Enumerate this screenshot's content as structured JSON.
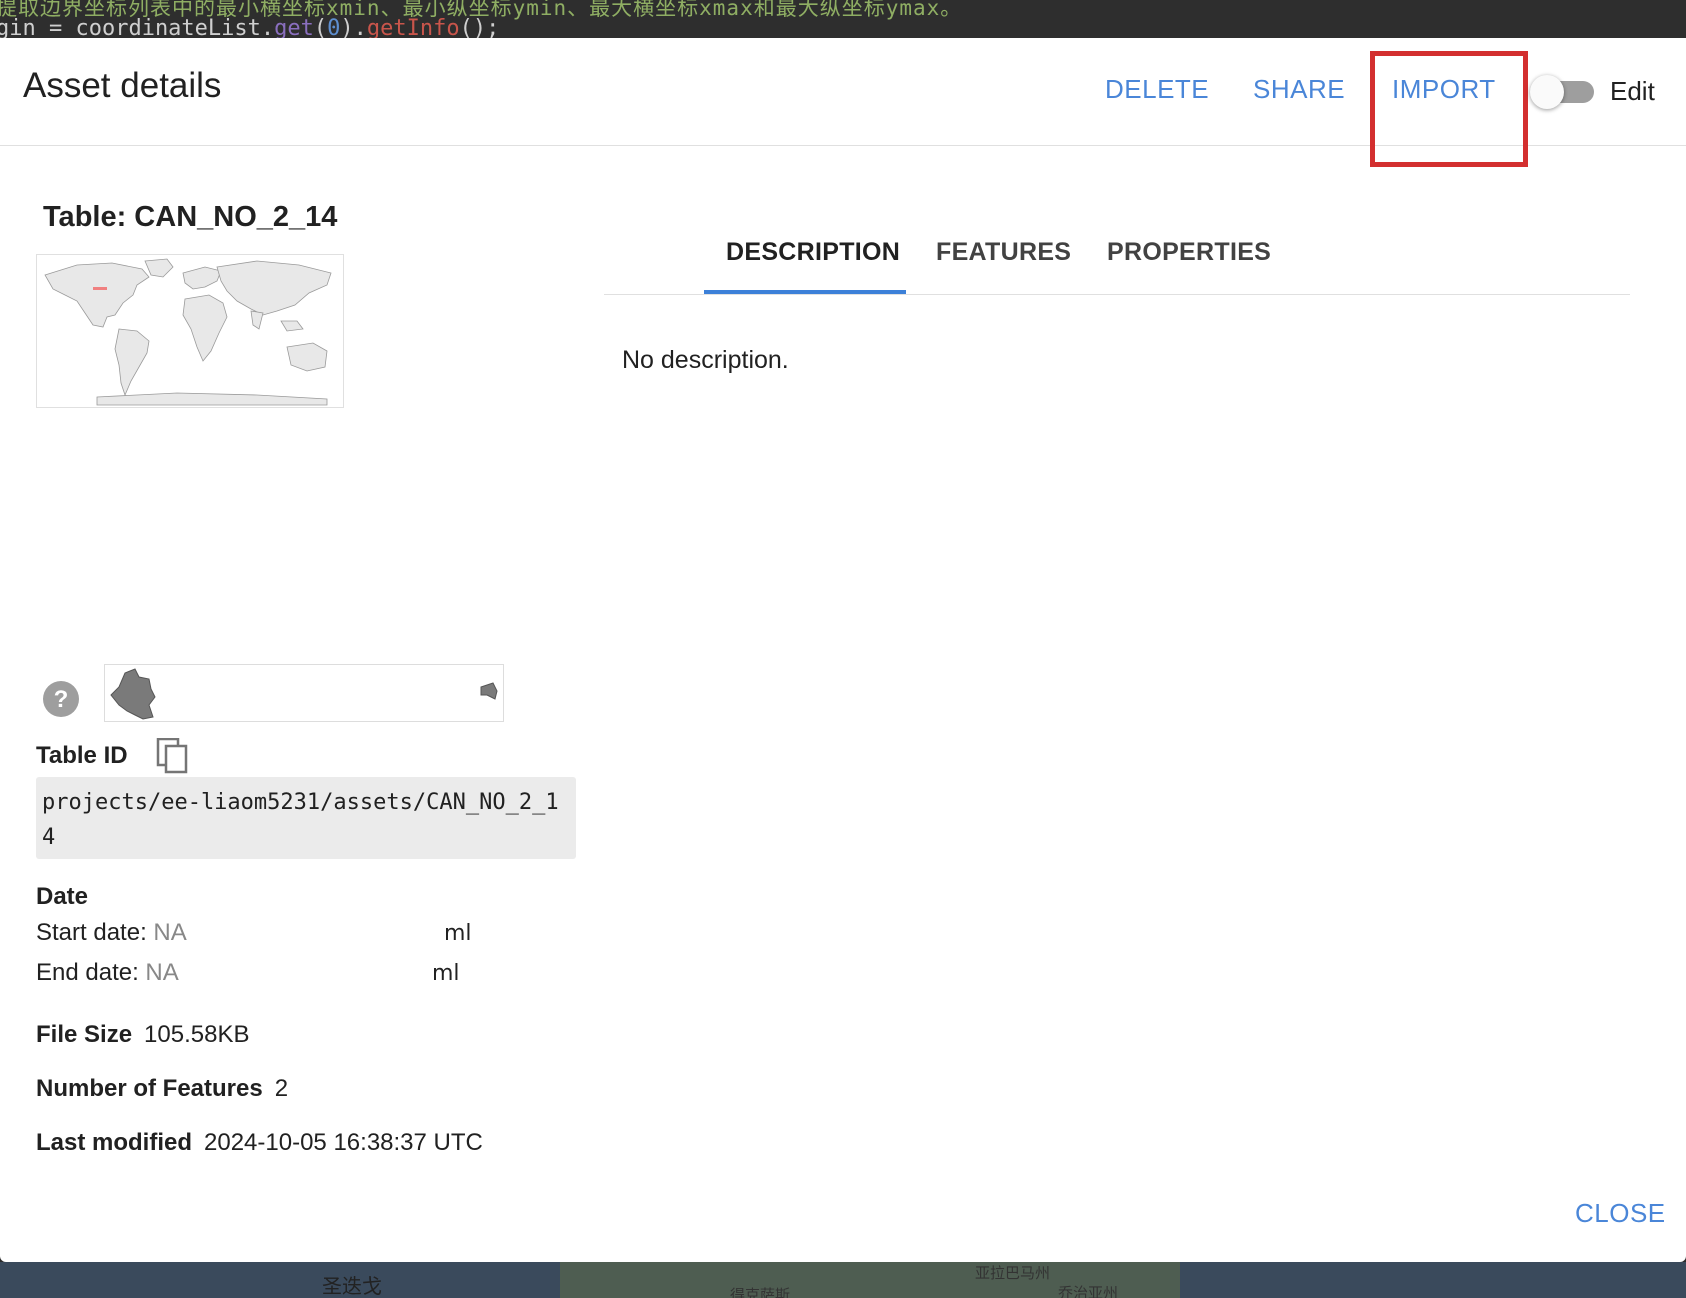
{
  "background": {
    "editor_line1": "提取边界坐标列表中的最小横坐标xmin、最小纵坐标ymin、最大横坐标xmax和最大纵坐标ymax。",
    "editor_line2_prefix": "gin = coordinateList.",
    "editor_line2_get": "get",
    "editor_line2_arg": "0",
    "editor_line2_getinfo": "getInfo",
    "map_label_1": "圣迭戈",
    "map_label_2": "亚拉巴马州",
    "map_label_3": "得克萨斯",
    "map_label_4": "乔治亚州"
  },
  "dialog": {
    "title": "Asset details",
    "actions": {
      "delete": "DELETE",
      "share": "SHARE",
      "import": "IMPORT"
    },
    "edit_toggle_label": "Edit",
    "close": "CLOSE"
  },
  "asset": {
    "table_title": "Table: CAN_NO_2_14",
    "table_id_label": "Table ID",
    "table_id": "projects/ee-liaom5231/assets/CAN_NO_2_14",
    "date_label": "Date",
    "start_date_label": "Start date:",
    "start_date_value": "NA",
    "end_date_label": "End date:",
    "end_date_value": "NA",
    "calendar_glyph": "ml",
    "file_size_label": "File Size",
    "file_size_value": "105.58KB",
    "features_label": "Number of Features",
    "features_value": "2",
    "modified_label": "Last modified",
    "modified_value": "2024-10-05 16:38:37 UTC"
  },
  "tabs": [
    {
      "label": "DESCRIPTION",
      "active": true
    },
    {
      "label": "FEATURES",
      "active": false
    },
    {
      "label": "PROPERTIES",
      "active": false
    }
  ],
  "description": "No description.",
  "colors": {
    "accent": "#4a86d8",
    "highlight_box": "#d32f2f",
    "tab_underline": "#3c80d8"
  },
  "icons": [
    "help-icon",
    "copy-icon",
    "world-map-thumbnail",
    "geometry-preview"
  ]
}
